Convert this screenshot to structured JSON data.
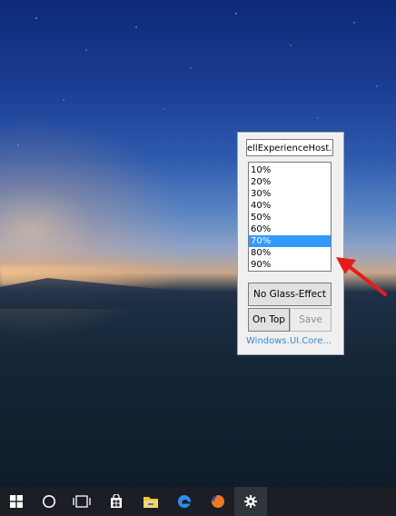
{
  "tool_window": {
    "process_field_value": "ellExperienceHost.e",
    "opacity_options": [
      "10%",
      "20%",
      "30%",
      "40%",
      "50%",
      "60%",
      "70%",
      "80%",
      "90%"
    ],
    "selected_opacity": "70%",
    "no_glass_button": "No Glass-Effect",
    "on_top_button": "On Top",
    "save_button": "Save",
    "window_class_link": "Windows.UI.Core..."
  },
  "taskbar": {
    "items": [
      "windows-start",
      "cortana",
      "task-view",
      "store",
      "file-explorer",
      "edge",
      "firefox",
      "settings"
    ]
  },
  "colors": {
    "selection": "#3399ff",
    "link": "#3a8ad0",
    "taskbar": "#1b1e24",
    "arrow": "#e51c1c"
  }
}
